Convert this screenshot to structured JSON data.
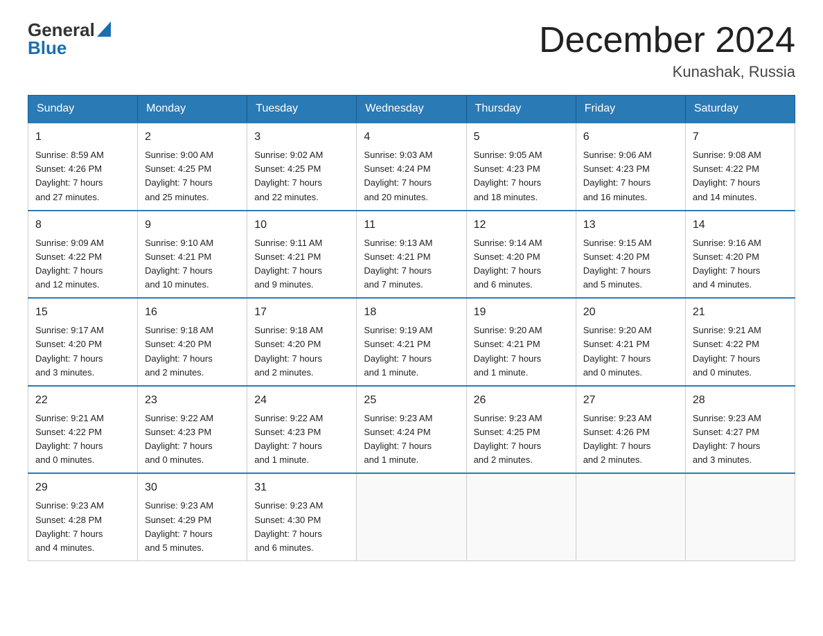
{
  "logo": {
    "text_general": "General",
    "text_blue": "Blue",
    "aria": "GeneralBlue logo"
  },
  "title": {
    "month_year": "December 2024",
    "location": "Kunashak, Russia"
  },
  "weekdays": [
    "Sunday",
    "Monday",
    "Tuesday",
    "Wednesday",
    "Thursday",
    "Friday",
    "Saturday"
  ],
  "weeks": [
    [
      {
        "day": "1",
        "sunrise": "8:59 AM",
        "sunset": "4:26 PM",
        "daylight": "7 hours and 27 minutes."
      },
      {
        "day": "2",
        "sunrise": "9:00 AM",
        "sunset": "4:25 PM",
        "daylight": "7 hours and 25 minutes."
      },
      {
        "day": "3",
        "sunrise": "9:02 AM",
        "sunset": "4:25 PM",
        "daylight": "7 hours and 22 minutes."
      },
      {
        "day": "4",
        "sunrise": "9:03 AM",
        "sunset": "4:24 PM",
        "daylight": "7 hours and 20 minutes."
      },
      {
        "day": "5",
        "sunrise": "9:05 AM",
        "sunset": "4:23 PM",
        "daylight": "7 hours and 18 minutes."
      },
      {
        "day": "6",
        "sunrise": "9:06 AM",
        "sunset": "4:23 PM",
        "daylight": "7 hours and 16 minutes."
      },
      {
        "day": "7",
        "sunrise": "9:08 AM",
        "sunset": "4:22 PM",
        "daylight": "7 hours and 14 minutes."
      }
    ],
    [
      {
        "day": "8",
        "sunrise": "9:09 AM",
        "sunset": "4:22 PM",
        "daylight": "7 hours and 12 minutes."
      },
      {
        "day": "9",
        "sunrise": "9:10 AM",
        "sunset": "4:21 PM",
        "daylight": "7 hours and 10 minutes."
      },
      {
        "day": "10",
        "sunrise": "9:11 AM",
        "sunset": "4:21 PM",
        "daylight": "7 hours and 9 minutes."
      },
      {
        "day": "11",
        "sunrise": "9:13 AM",
        "sunset": "4:21 PM",
        "daylight": "7 hours and 7 minutes."
      },
      {
        "day": "12",
        "sunrise": "9:14 AM",
        "sunset": "4:20 PM",
        "daylight": "7 hours and 6 minutes."
      },
      {
        "day": "13",
        "sunrise": "9:15 AM",
        "sunset": "4:20 PM",
        "daylight": "7 hours and 5 minutes."
      },
      {
        "day": "14",
        "sunrise": "9:16 AM",
        "sunset": "4:20 PM",
        "daylight": "7 hours and 4 minutes."
      }
    ],
    [
      {
        "day": "15",
        "sunrise": "9:17 AM",
        "sunset": "4:20 PM",
        "daylight": "7 hours and 3 minutes."
      },
      {
        "day": "16",
        "sunrise": "9:18 AM",
        "sunset": "4:20 PM",
        "daylight": "7 hours and 2 minutes."
      },
      {
        "day": "17",
        "sunrise": "9:18 AM",
        "sunset": "4:20 PM",
        "daylight": "7 hours and 2 minutes."
      },
      {
        "day": "18",
        "sunrise": "9:19 AM",
        "sunset": "4:21 PM",
        "daylight": "7 hours and 1 minute."
      },
      {
        "day": "19",
        "sunrise": "9:20 AM",
        "sunset": "4:21 PM",
        "daylight": "7 hours and 1 minute."
      },
      {
        "day": "20",
        "sunrise": "9:20 AM",
        "sunset": "4:21 PM",
        "daylight": "7 hours and 0 minutes."
      },
      {
        "day": "21",
        "sunrise": "9:21 AM",
        "sunset": "4:22 PM",
        "daylight": "7 hours and 0 minutes."
      }
    ],
    [
      {
        "day": "22",
        "sunrise": "9:21 AM",
        "sunset": "4:22 PM",
        "daylight": "7 hours and 0 minutes."
      },
      {
        "day": "23",
        "sunrise": "9:22 AM",
        "sunset": "4:23 PM",
        "daylight": "7 hours and 0 minutes."
      },
      {
        "day": "24",
        "sunrise": "9:22 AM",
        "sunset": "4:23 PM",
        "daylight": "7 hours and 1 minute."
      },
      {
        "day": "25",
        "sunrise": "9:23 AM",
        "sunset": "4:24 PM",
        "daylight": "7 hours and 1 minute."
      },
      {
        "day": "26",
        "sunrise": "9:23 AM",
        "sunset": "4:25 PM",
        "daylight": "7 hours and 2 minutes."
      },
      {
        "day": "27",
        "sunrise": "9:23 AM",
        "sunset": "4:26 PM",
        "daylight": "7 hours and 2 minutes."
      },
      {
        "day": "28",
        "sunrise": "9:23 AM",
        "sunset": "4:27 PM",
        "daylight": "7 hours and 3 minutes."
      }
    ],
    [
      {
        "day": "29",
        "sunrise": "9:23 AM",
        "sunset": "4:28 PM",
        "daylight": "7 hours and 4 minutes."
      },
      {
        "day": "30",
        "sunrise": "9:23 AM",
        "sunset": "4:29 PM",
        "daylight": "7 hours and 5 minutes."
      },
      {
        "day": "31",
        "sunrise": "9:23 AM",
        "sunset": "4:30 PM",
        "daylight": "7 hours and 6 minutes."
      },
      null,
      null,
      null,
      null
    ]
  ],
  "labels": {
    "sunrise": "Sunrise:",
    "sunset": "Sunset:",
    "daylight": "Daylight:"
  }
}
